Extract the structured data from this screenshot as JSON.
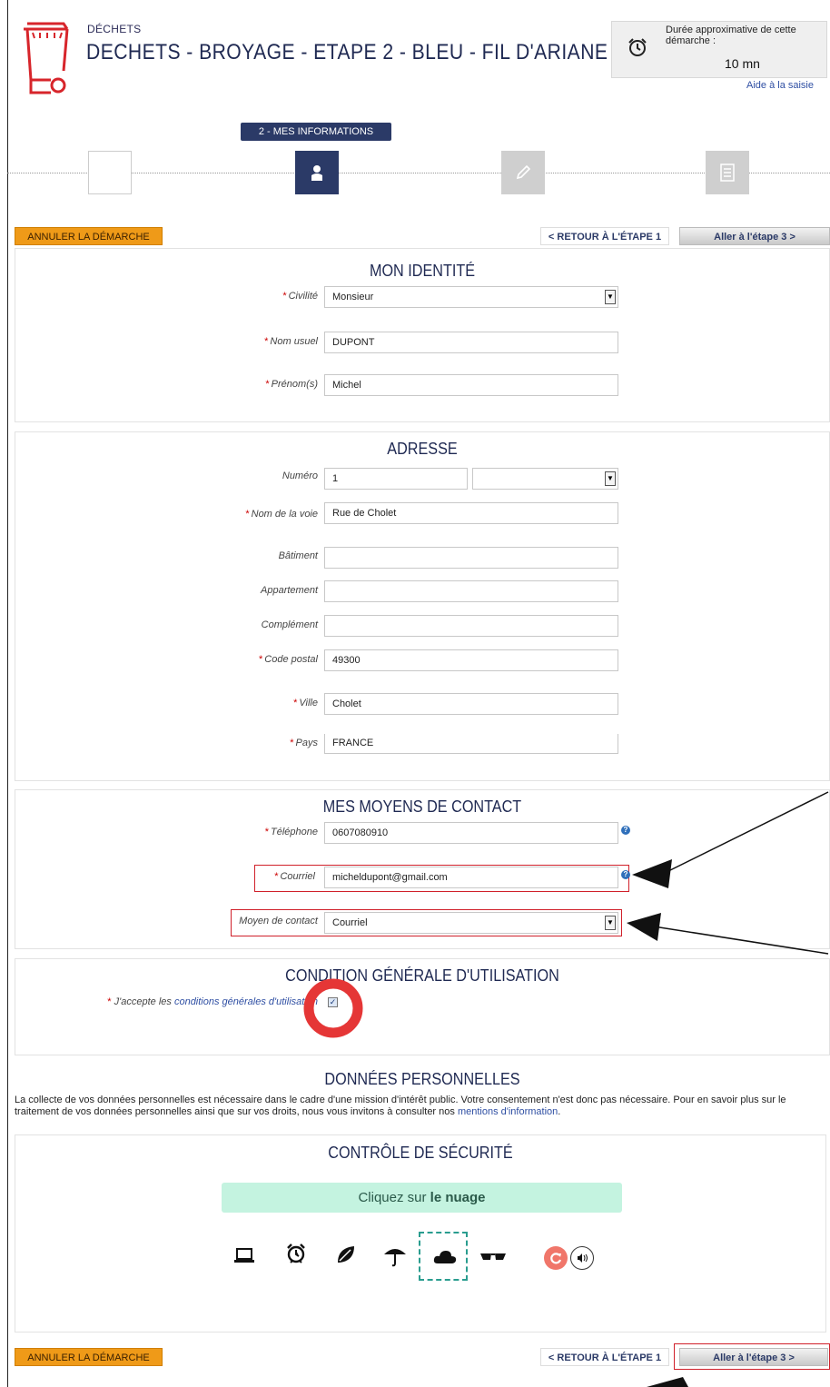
{
  "header": {
    "category": "DÉCHETS",
    "title": "DECHETS - BROYAGE - ETAPE 2 - BLEU - FIL D'ARIANE",
    "duration_label": "Durée approximative de cette démarche :",
    "duration_value": "10 mn",
    "help_link": "Aide à la saisie"
  },
  "stepper": {
    "current_step": "2 - MES INFORMATIONS",
    "icons": [
      "blank",
      "user-icon",
      "pencil-icon",
      "document-icon"
    ]
  },
  "nav": {
    "cancel": "ANNULER LA DÉMARCHE",
    "back": "< RETOUR À L'ÉTAPE 1",
    "next": "Aller à l'étape 3 >"
  },
  "identity": {
    "title": "MON IDENTITÉ",
    "civilite_label": "Civilité",
    "civilite_value": "Monsieur",
    "nom_label": "Nom usuel",
    "nom_value": "DUPONT",
    "prenom_label": "Prénom(s)",
    "prenom_value": "Michel"
  },
  "address": {
    "title": "ADRESSE",
    "numero_label": "Numéro",
    "numero_value": "1",
    "voie_label": "Nom de la voie",
    "voie_value": "Rue de Cholet",
    "batiment_label": "Bâtiment",
    "appartement_label": "Appartement",
    "complement_label": "Complément",
    "cp_label": "Code postal",
    "cp_value": "49300",
    "ville_label": "Ville",
    "ville_value": "Cholet",
    "pays_label": "Pays",
    "pays_value": "FRANCE"
  },
  "contact": {
    "title": "MES MOYENS DE CONTACT",
    "tel_label": "Téléphone",
    "tel_value": "0607080910",
    "mail_label": "Courriel",
    "mail_value": "micheldupont@gmail.com",
    "moyen_label": "Moyen de contact",
    "moyen_value": "Courriel"
  },
  "cgu": {
    "title": "CONDITION GÉNÉRALE D'UTILISATION",
    "accept_prefix": "J'accepte les",
    "accept_link": "conditions générales d'utilisation",
    "checked": true
  },
  "donnees": {
    "title": "DONNÉES PERSONNELLES",
    "text": "La collecte de vos données personnelles est nécessaire dans le cadre d'une mission d'intérêt public. Votre consentement n'est donc pas nécessaire. Pour en savoir plus sur le traitement de vos données personnelles ainsi que sur vos droits, nous vous invitons à consulter nos",
    "link": "mentions d'information",
    "end": "."
  },
  "securite": {
    "title": "CONTRÔLE DE SÉCURITÉ",
    "instruction_prefix": "Cliquez sur",
    "instruction_target": "le nuage",
    "icons": [
      "laptop-icon",
      "alarm-clock-icon",
      "leaf-icon",
      "umbrella-icon",
      "cloud-icon",
      "sunglasses-icon"
    ],
    "selected": "cloud-icon"
  },
  "colors": {
    "navy": "#1f2952",
    "orange": "#ef9a18",
    "annotation_red": "#e53636",
    "captcha_green": "#c4f3e0",
    "refresh": "#f0766a"
  }
}
